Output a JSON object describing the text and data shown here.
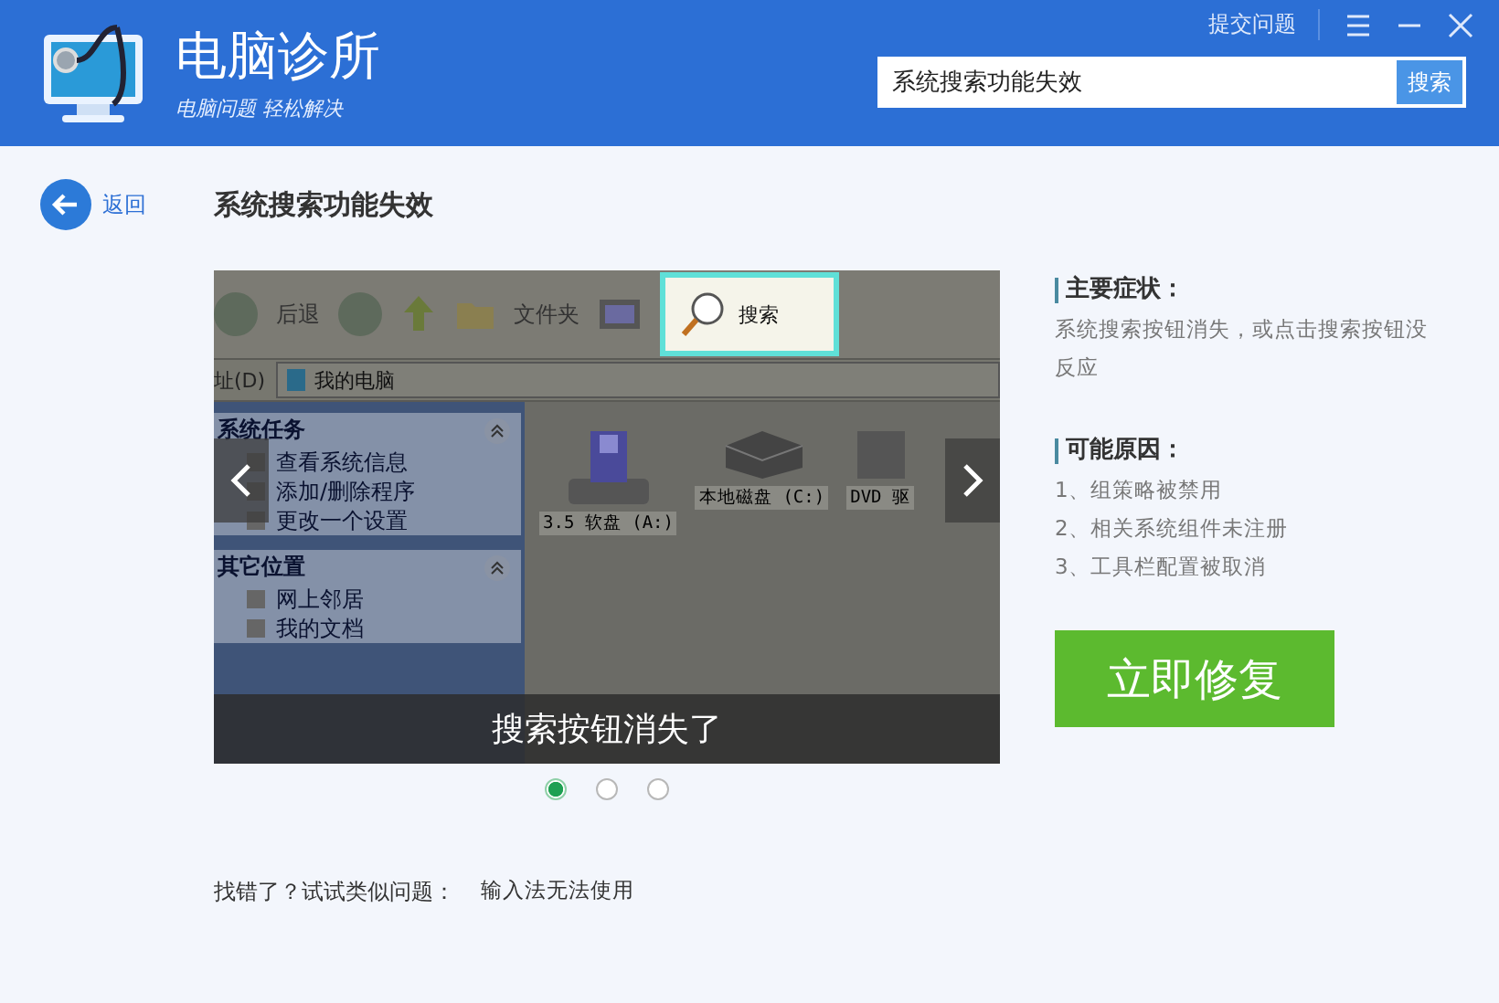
{
  "header": {
    "app_title": "电脑诊所",
    "app_subtitle": "电脑问题 轻松解决",
    "search": {
      "value": "系统搜索功能失效",
      "button": "搜索"
    },
    "feedback_link": "提交问题"
  },
  "back_button": "返回",
  "page_title": "系统搜索功能失效",
  "slide": {
    "toolbar": [
      "后退",
      "文件夹"
    ],
    "search_button": "搜索",
    "address_label": "址(D)",
    "address_value": "我的电脑",
    "task_panels": [
      {
        "title": "系统任务",
        "items": [
          "查看系统信息",
          "添加/删除程序",
          "更改一个设置"
        ]
      },
      {
        "title": "其它位置",
        "items": [
          "网上邻居",
          "我的文档"
        ]
      }
    ],
    "drives": [
      {
        "kind": "floppy",
        "label": "3.5 软盘 (A:)"
      },
      {
        "kind": "disk",
        "label": "本地磁盘 (C:)"
      },
      {
        "kind": "dvd",
        "label": "DVD 驱"
      }
    ],
    "caption": "搜索按钮消失了"
  },
  "slide_dots": [
    {
      "selected": true
    },
    {
      "selected": false
    },
    {
      "selected": false
    }
  ],
  "symptoms": {
    "heading": "主要症状：",
    "text": "系统搜索按钮消失，或点击搜索按钮没反应"
  },
  "causes": {
    "heading": "可能原因：",
    "items": [
      "1、组策略被禁用",
      "2、相关系统组件未注册",
      "3、工具栏配置被取消"
    ]
  },
  "fix_button": "立即修复",
  "suggestion": {
    "label": "找错了？试试类似问题：",
    "link": "输入法无法使用"
  }
}
